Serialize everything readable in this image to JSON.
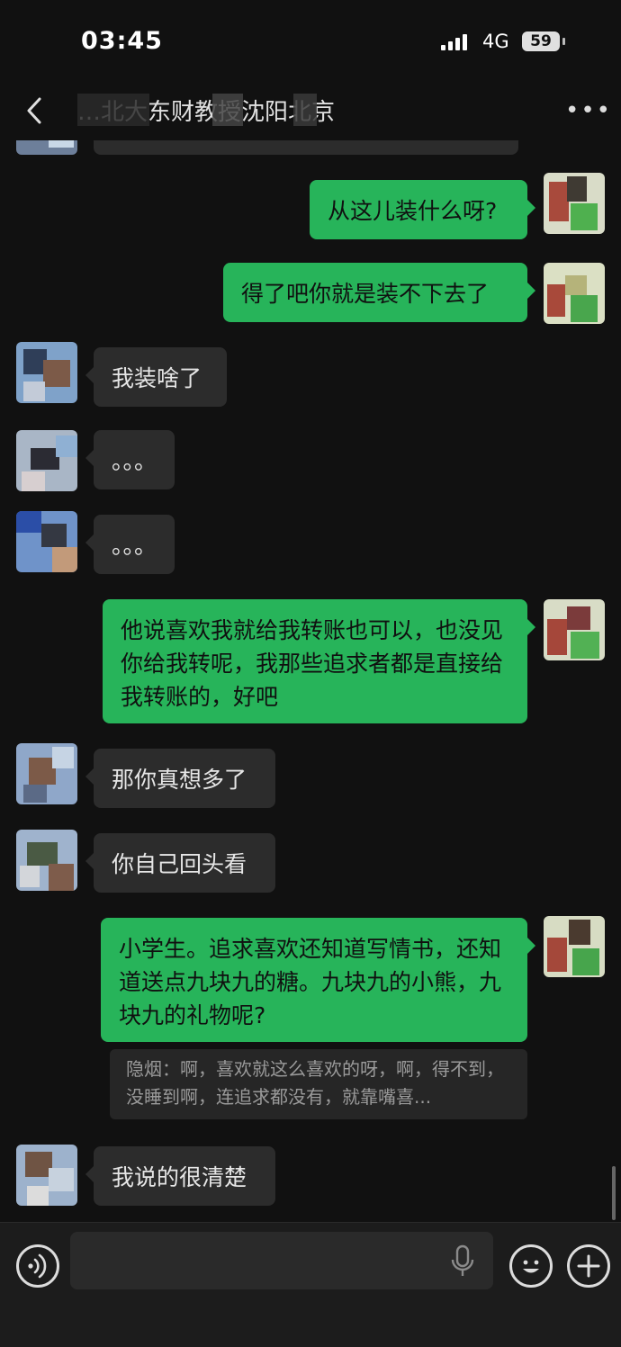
{
  "status_bar": {
    "time": "03:45",
    "network": "4G",
    "battery": "59"
  },
  "header": {
    "title_visible_text": "…北大东财教授沈阳北京",
    "more_label": "•••"
  },
  "messages": [
    {
      "side": "out",
      "text": "从这儿装什么呀?"
    },
    {
      "side": "out",
      "text": "得了吧你就是装不下去了"
    },
    {
      "side": "in",
      "text": "我装啥了"
    },
    {
      "side": "in",
      "text": "。。。"
    },
    {
      "side": "in",
      "text": "。。。"
    },
    {
      "side": "out",
      "text": "他说喜欢我就给我转账也可以，也没见你给我转呢，我那些追求者都是直接给我转账的，好吧"
    },
    {
      "side": "in",
      "text": "那你真想多了"
    },
    {
      "side": "in",
      "text": "你自己回头看"
    },
    {
      "side": "out",
      "text": "小学生。追求喜欢还知道写情书，还知道送点九块九的糖。九块九的小熊，九块九的礼物呢?"
    },
    {
      "side": "in",
      "text": "我说的很清楚"
    }
  ],
  "quote": {
    "text": "隐烟：啊，喜欢就这么喜欢的呀，啊，得不到，没睡到啊，连追求都没有，就靠嘴喜..."
  },
  "input_bar": {
    "placeholder": ""
  },
  "icons": {
    "back": "chevron-left-icon",
    "more": "more-dots-icon",
    "voice": "voice-icon",
    "mic": "microphone-icon",
    "emoji": "emoji-icon",
    "plus": "plus-icon"
  },
  "colors": {
    "background": "#111111",
    "incoming_bubble": "#2c2c2c",
    "outgoing_bubble": "#27b45a"
  }
}
